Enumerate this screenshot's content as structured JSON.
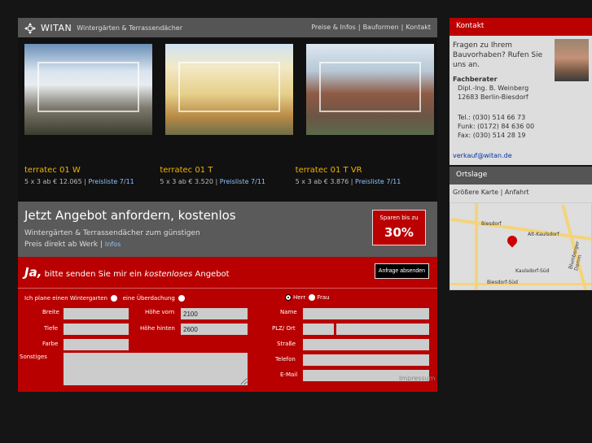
{
  "header": {
    "logo": "WITAN",
    "tagline": "Wintergärten & Terrassendächer",
    "nav": [
      "Preise & Infos",
      "Bauformen",
      "Kontakt"
    ]
  },
  "products": [
    {
      "name": "terratec 01 W",
      "price": "5 x 3 ab € 12.065",
      "link": "Preisliste 7/11"
    },
    {
      "name": "terratec 01 T",
      "price": "5 x 3 ab € 3.520",
      "link": "Preisliste 7/11"
    },
    {
      "name": "terratec 01 T VR",
      "price": "5 x 3 ab € 3.876",
      "link": "Preisliste 7/11"
    }
  ],
  "offer": {
    "title": "Jetzt Angebot anfordern, kostenlos",
    "sub": "Wintergärten & Terrassendächer zum günstigen Preis direkt ab Werk",
    "sub_sep": "|",
    "sub_link": "Infos",
    "badge_small": "Sparen bis zu",
    "badge_big": "30%"
  },
  "form": {
    "head_bold": "Ja,",
    "head_1": "bitte senden Sie mir ein",
    "head_italic": "kostenloses",
    "head_2": "Angebot",
    "submit": "Anfrage absenden",
    "plan_label": "Ich plane einen Wintergarten",
    "plan_option_2": "eine Überdachung",
    "salutation_1": "Herr",
    "salutation_2": "Frau",
    "fields": {
      "breite": "Breite",
      "tiefe": "Tiefe",
      "farbe": "Farbe",
      "sonstiges": "Sonstiges",
      "hoehe_vorn": "Höhe vorn",
      "hoehe_vorn_value": "2100",
      "hoehe_hinten": "Höhe hinten",
      "hoehe_hinten_value": "2600",
      "name": "Name",
      "plz": "PLZ/ Ort",
      "strasse": "Straße",
      "telefon": "Telefon",
      "email": "E-Mail"
    }
  },
  "footer": {
    "impressum": "Impressum"
  },
  "sidebar": {
    "kontakt_head": "Kontakt",
    "intro": "Fragen zu Ihrem Bauvorhaben? Rufen Sie uns an.",
    "role": "Fachberater",
    "name": "Dipl.-Ing. B. Weinberg",
    "city": "12683 Berlin-Biesdorf",
    "tel": "Tel.: (030) 514 66 73",
    "funk": "Funk: (0172) 84 636 00",
    "fax": "Fax: (030) 514 28 19",
    "email": "verkauf@witan.de",
    "ortslage_head": "Ortslage",
    "map_link_1": "Größere Karte",
    "map_sep": "|",
    "map_link_2": "Anfahrt",
    "map_labels": [
      "Biesdorf",
      "Alt-Kaulsdorf",
      "Kaulsdorf-Süd",
      "Biesdorf-Süd",
      "Blumberger Damm"
    ]
  }
}
